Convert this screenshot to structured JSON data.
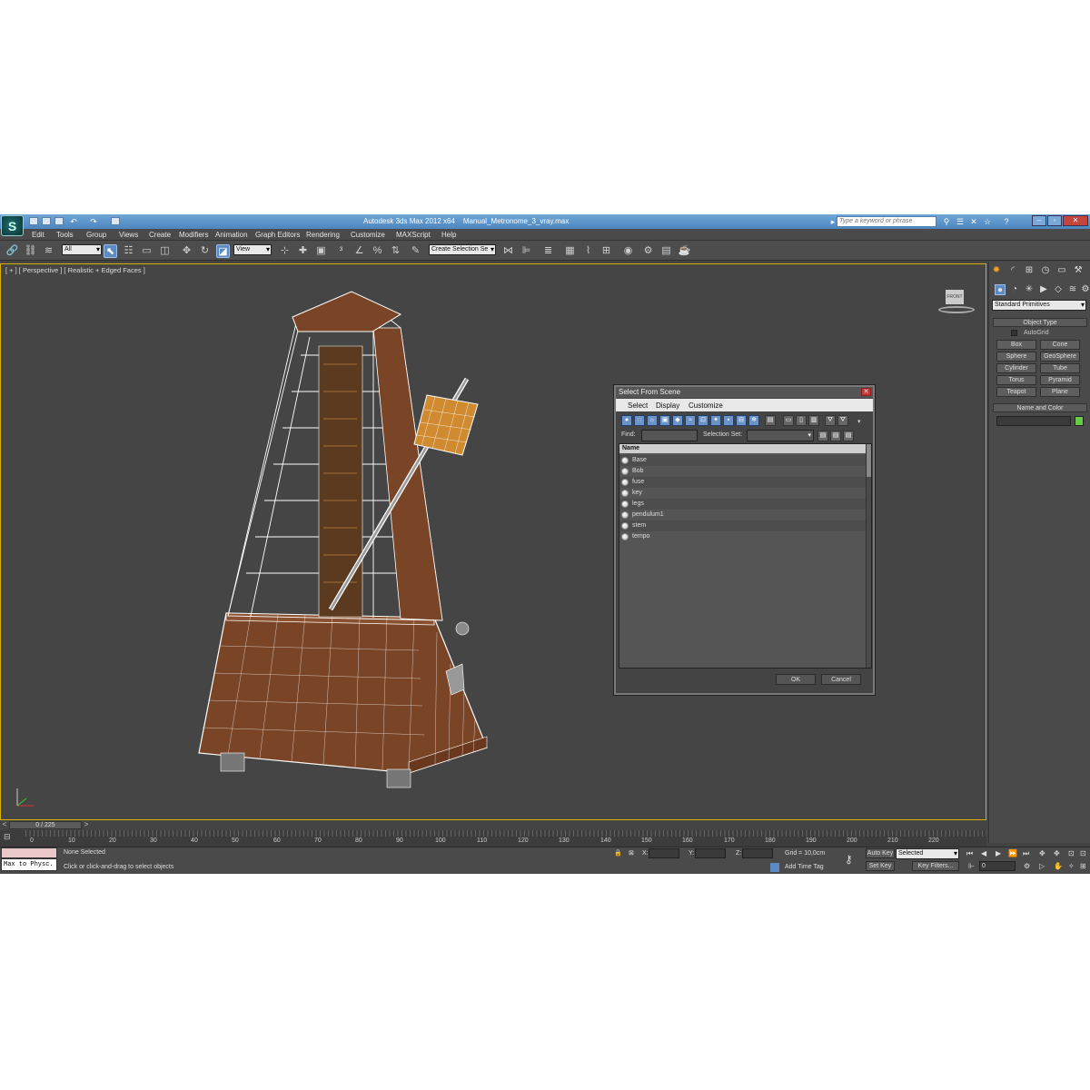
{
  "app": {
    "title": "Autodesk 3ds Max 2012 x64",
    "filename": "Manual_Metronome_3_vray.max",
    "search_placeholder": "Type a keyword or phrase"
  },
  "menu": [
    "Edit",
    "Tools",
    "Group",
    "Views",
    "Create",
    "Modifiers",
    "Animation",
    "Graph Editors",
    "Rendering",
    "Customize",
    "MAXScript",
    "Help"
  ],
  "toolbar": {
    "filter_value": "All",
    "ref_coord_value": "View",
    "selection_set_placeholder": "Create Selection Se"
  },
  "viewport": {
    "label": "[ + ] [ Perspective ] [ Realistic + Edged Faces ]",
    "viewcube_label": "FRONT"
  },
  "command_panel": {
    "category": "Standard Primitives",
    "object_type_header": "Object Type",
    "autogrid_label": "AutoGrid",
    "object_buttons": [
      "Box",
      "Cone",
      "Sphere",
      "GeoSphere",
      "Cylinder",
      "Tube",
      "Torus",
      "Pyramid",
      "Teapot",
      "Plane"
    ],
    "name_color_header": "Name and Color",
    "color": "#66cc44"
  },
  "dialog": {
    "title": "Select From Scene",
    "menu": [
      "Select",
      "Display",
      "Customize"
    ],
    "find_label": "Find:",
    "selection_set_label": "Selection Set:",
    "column_name": "Name",
    "objects": [
      "Base",
      "Bob",
      "fuse",
      "key",
      "legs",
      "pendulum1",
      "stem",
      "tempo"
    ],
    "ok_label": "OK",
    "cancel_label": "Cancel"
  },
  "timeline": {
    "frame_display": "0 / 225",
    "ticks": [
      "0",
      "10",
      "20",
      "30",
      "40",
      "50",
      "60",
      "70",
      "80",
      "90",
      "100",
      "110",
      "120",
      "130",
      "140",
      "150",
      "160",
      "170",
      "180",
      "190",
      "200",
      "210",
      "220"
    ]
  },
  "status": {
    "maxscript_text": "Max to Physc.",
    "selection_text": "None Selected",
    "prompt_text": "Click or click-and-drag to select objects",
    "x_label": "X:",
    "y_label": "Y:",
    "z_label": "Z:",
    "grid_text": "Grid = 10,0cm",
    "add_time_tag": "Add Time Tag",
    "auto_key": "Auto Key",
    "set_key": "Set Key",
    "key_mode_value": "Selected",
    "key_filters": "Key Filters...",
    "current_frame": "0"
  },
  "colors": {
    "wood": "#7a4426",
    "wireframe": "#ffffff",
    "accent": "#5c8bc4",
    "viewport_border": "#d8b000"
  }
}
